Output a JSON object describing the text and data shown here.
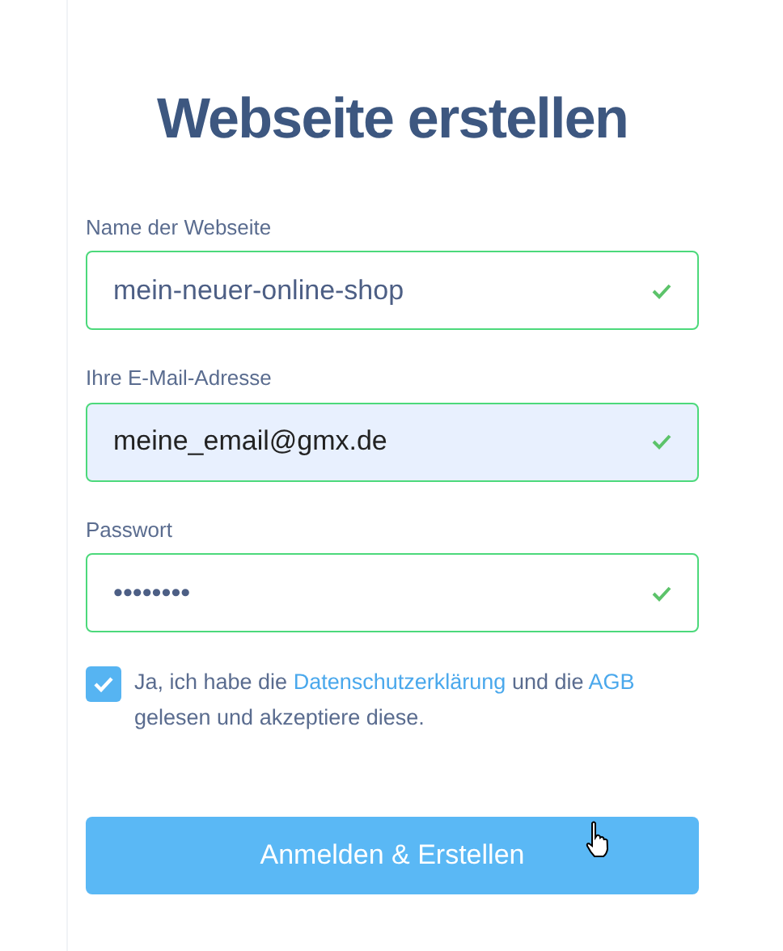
{
  "title": "Webseite erstellen",
  "fields": [
    {
      "label": "Name der Webseite",
      "value": "mein-neuer-online-shop",
      "valid": true,
      "autofilled": false
    },
    {
      "label": "Ihre E-Mail-Adresse",
      "value": "meine_email@gmx.de",
      "valid": true,
      "autofilled": true
    },
    {
      "label": "Passwort",
      "value": "••••••••",
      "valid": true,
      "autofilled": false
    }
  ],
  "consent": {
    "checked": true,
    "parts": [
      {
        "kind": "text",
        "text": "Ja, ich habe die"
      },
      {
        "kind": "link",
        "text": "Datenschutzerklärung"
      },
      {
        "kind": "text",
        "text": "und die"
      },
      {
        "kind": "link",
        "text": "AGB"
      },
      {
        "kind": "text",
        "text": "gelesen und akzeptiere diese."
      }
    ]
  },
  "submit": {
    "label": "Anmelden & Erstellen"
  }
}
